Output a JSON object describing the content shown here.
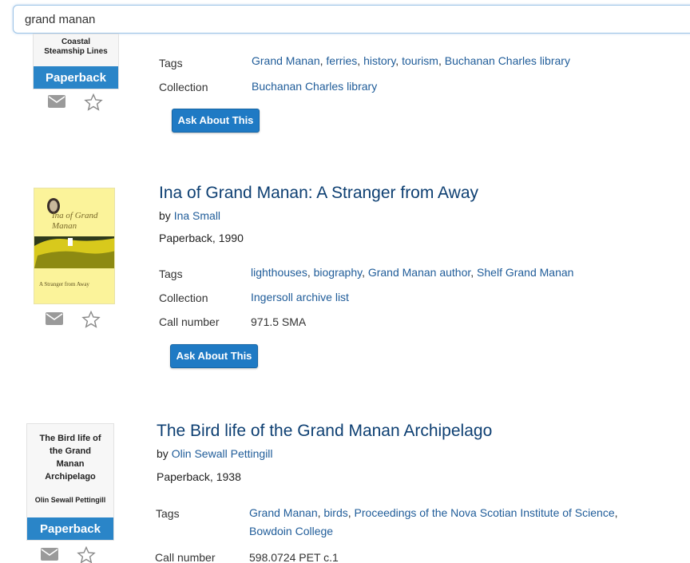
{
  "search": {
    "value": "grand manan"
  },
  "records": [
    {
      "cover_text": "Coastal Steamship Lines",
      "format_badge": "Paperback",
      "props": [
        {
          "label": "Tags",
          "links": [
            "Grand Manan",
            "ferries",
            "history",
            "tourism",
            "Buchanan Charles library"
          ]
        },
        {
          "label": "Collection",
          "links": [
            "Buchanan Charles library"
          ]
        }
      ],
      "ask_label": "Ask About This"
    },
    {
      "title": "Ina of Grand Manan: A Stranger from Away",
      "by": "by",
      "author": "Ina Small",
      "format": "Paperback, 1990",
      "cover_title": "Ina of Grand Manan",
      "cover_subtitle": "A Stranger from Away",
      "props": [
        {
          "label": "Tags",
          "links": [
            "lighthouses",
            "biography",
            "Grand Manan author",
            "Shelf Grand Manan"
          ]
        },
        {
          "label": "Collection",
          "links": [
            "Ingersoll archive list"
          ]
        },
        {
          "label": "Call number",
          "value": "971.5 SMA"
        }
      ],
      "ask_label": "Ask About This"
    },
    {
      "title": "The Bird life of the Grand Manan Archipelago",
      "by": "by",
      "author": "Olin Sewall Pettingill",
      "format": "Paperback, 1938",
      "cover_title": "The Bird life of the Grand Manan Archipelago",
      "cover_author": "Olin Sewall Pettingill",
      "format_badge": "Paperback",
      "props": [
        {
          "label": "Tags",
          "links_line1": [
            "Grand Manan",
            "birds",
            "Proceedings of the Nova Scotian Institute of Science"
          ],
          "links_line2": [
            "Bowdoin College"
          ]
        },
        {
          "label": "Call number",
          "value": "598.0724 PET c.1"
        }
      ]
    }
  ],
  "icons": {
    "email": "envelope-icon",
    "favorite": "star-icon"
  }
}
